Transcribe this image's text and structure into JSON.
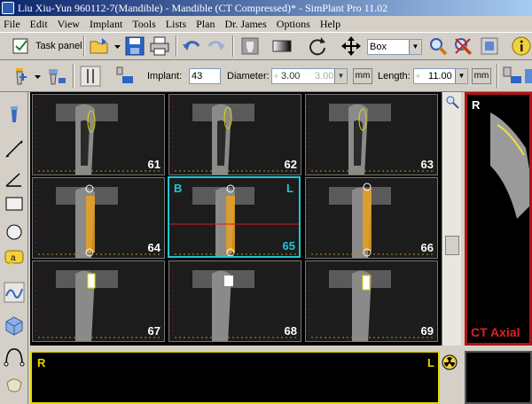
{
  "window": {
    "title": "Liu Xiu-Yun 960112-7(Mandible) - Mandible (CT Compressed)* - SimPlant Pro  11.02"
  },
  "menu": [
    "File",
    "Edit",
    "View",
    "Implant",
    "Tools",
    "Lists",
    "Plan",
    "Dr. James",
    "Options",
    "Help"
  ],
  "toolbar": {
    "task_panel_label": "Task panel",
    "view_mode": "Box"
  },
  "implant_bar": {
    "implant_label": "Implant:",
    "implant_value": "43",
    "diameter_label": "Diameter:",
    "diameter_value": "3.00",
    "diameter_alt": "3.00",
    "diameter_unit": "mm",
    "length_label": "Length:",
    "length_value": "11.00",
    "length_unit": "mm"
  },
  "slices": [
    "61",
    "62",
    "63",
    "64",
    "65",
    "66",
    "67",
    "68",
    "69"
  ],
  "selected_slice": "65",
  "selected_orient_left": "B",
  "selected_orient_right": "L",
  "axial_view": {
    "orientation": "R",
    "title": "CT Axial"
  },
  "bottom_view": {
    "left_label": "R",
    "right_label": "L"
  },
  "colors": {
    "selected_border": "#1ec8d6",
    "axial_border": "#b01212",
    "bottom_border": "#e6d800",
    "implant": "#e8a020"
  }
}
